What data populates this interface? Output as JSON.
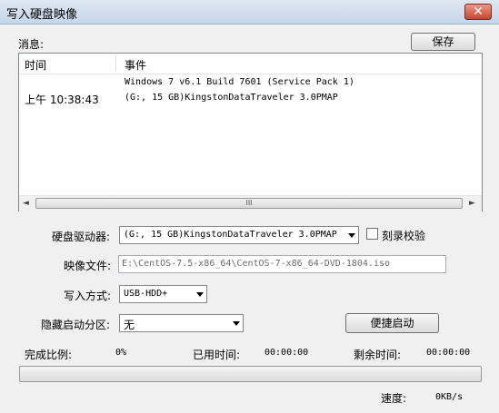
{
  "window": {
    "title": "写入硬盘映像",
    "close_label": "✕"
  },
  "messages": {
    "label": "消息:",
    "save_label": "保存",
    "columns": [
      "时间",
      "事件"
    ],
    "rows": [
      {
        "time": "",
        "event": "Windows 7 v6.1 Build 7601 (Service Pack 1)"
      },
      {
        "time": "上午 10:38:43",
        "event": "(G:, 15 GB)KingstonDataTraveler 3.0PMAP"
      }
    ],
    "scroll_thumb": "III"
  },
  "form": {
    "drive_label": "硬盘驱动器:",
    "drive_value": "(G:, 15 GB)KingstonDataTraveler 3.0PMAP",
    "verify_label": "刻录校验",
    "verify_checked": false,
    "image_label": "映像文件:",
    "image_value": "E:\\CentOS-7.5-x86_64\\CentOS-7-x86_64-DVD-1804.iso",
    "write_mode_label": "写入方式:",
    "write_mode_value": "USB-HDD+",
    "hidden_label": "隐藏启动分区:",
    "hidden_value": "无",
    "quick_boot_label": "便捷启动"
  },
  "status": {
    "progress_label": "完成比例:",
    "progress_value": "0%",
    "progress_fraction": 0,
    "elapsed_label": "已用时间:",
    "elapsed_value": "00:00:00",
    "remaining_label": "剩余时间:",
    "remaining_value": "00:00:00",
    "speed_label": "速度:",
    "speed_value": "0KB/s"
  }
}
